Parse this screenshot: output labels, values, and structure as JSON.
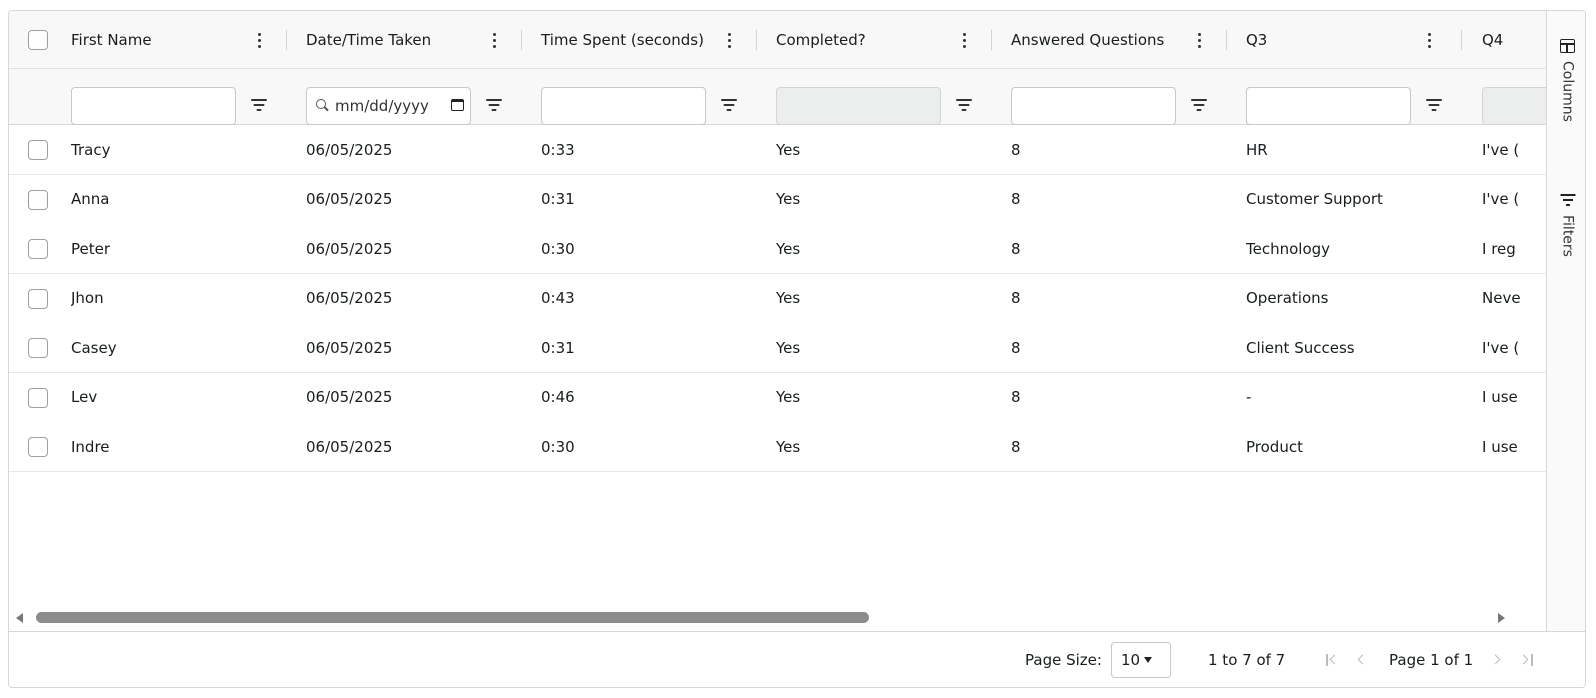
{
  "columns": [
    {
      "label": "First Name"
    },
    {
      "label": "Date/Time Taken"
    },
    {
      "label": "Time Spent (seconds)"
    },
    {
      "label": "Completed?"
    },
    {
      "label": "Answered Questions"
    },
    {
      "label": "Q3"
    },
    {
      "label": "Q4"
    }
  ],
  "filters": {
    "date_placeholder": "mm/dd/yyyy"
  },
  "rows": [
    {
      "first_name": "Tracy",
      "date": "06/05/2025",
      "time_spent": "0:33",
      "completed": "Yes",
      "answered": "8",
      "q3": "HR",
      "q4": "I've ("
    },
    {
      "first_name": "Anna",
      "date": "06/05/2025",
      "time_spent": "0:31",
      "completed": "Yes",
      "answered": "8",
      "q3": "Customer Support",
      "q4": "I've ("
    },
    {
      "first_name": "Peter",
      "date": "06/05/2025",
      "time_spent": "0:30",
      "completed": "Yes",
      "answered": "8",
      "q3": "Technology",
      "q4": "I reg"
    },
    {
      "first_name": "Jhon",
      "date": "06/05/2025",
      "time_spent": "0:43",
      "completed": "Yes",
      "answered": "8",
      "q3": "Operations",
      "q4": "Neve"
    },
    {
      "first_name": "Casey",
      "date": "06/05/2025",
      "time_spent": "0:31",
      "completed": "Yes",
      "answered": "8",
      "q3": "Client Success",
      "q4": "I've ("
    },
    {
      "first_name": "Lev",
      "date": "06/05/2025",
      "time_spent": "0:46",
      "completed": "Yes",
      "answered": "8",
      "q3": "-",
      "q4": "I use"
    },
    {
      "first_name": "Indre",
      "date": "06/05/2025",
      "time_spent": "0:30",
      "completed": "Yes",
      "answered": "8",
      "q3": "Product",
      "q4": "I use"
    }
  ],
  "side_bar": {
    "columns_label": "Columns",
    "filters_label": "Filters"
  },
  "pagination": {
    "page_size_label": "Page Size:",
    "page_size_value": "10",
    "range_text": "1 to 7 of 7",
    "page_text": "Page 1 of 1"
  }
}
